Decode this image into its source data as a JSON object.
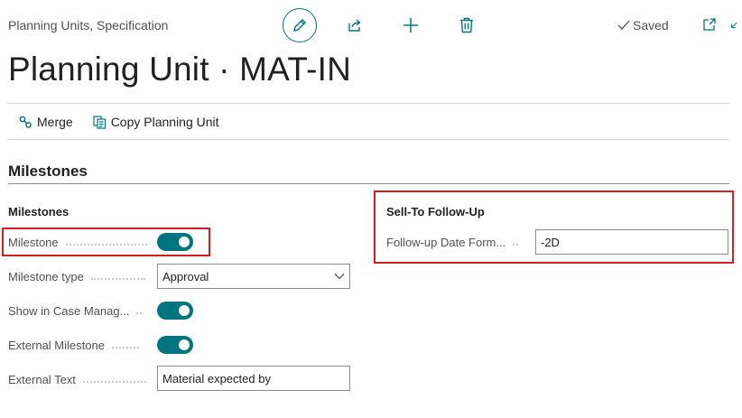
{
  "header": {
    "breadcrumb": "Planning Units, Specification",
    "saved_label": "Saved",
    "title": "Planning Unit · MAT-IN"
  },
  "actions": [
    {
      "label": "Merge",
      "icon": "merge-icon"
    },
    {
      "label": "Copy Planning Unit",
      "icon": "copy-icon"
    }
  ],
  "section": {
    "title": "Milestones"
  },
  "milestones_group": {
    "title": "Milestones",
    "milestone": {
      "label": "Milestone",
      "value": true
    },
    "milestone_type": {
      "label": "Milestone type",
      "value": "Approval"
    },
    "show_in_case": {
      "label": "Show in Case Manag...",
      "value": true
    },
    "external_milestone": {
      "label": "External Milestone",
      "value": true
    },
    "external_text": {
      "label": "External Text",
      "value": "Material expected by"
    }
  },
  "sell_to_group": {
    "title": "Sell-To Follow-Up",
    "follow_up": {
      "label": "Follow-up Date Form...",
      "value": "-2D"
    }
  },
  "colors": {
    "accent": "#00757f",
    "highlight": "#d31f1f"
  }
}
